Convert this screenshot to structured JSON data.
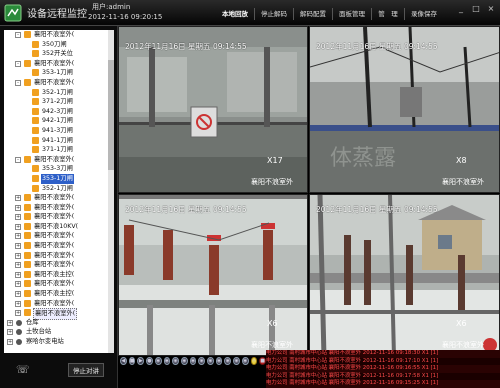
{
  "app": {
    "title": "设备远程监控",
    "user_line": "用户:admin",
    "datetime": "2012-11-16   09:20:15"
  },
  "topnav": [
    "本地回放",
    "停止解码",
    "解码配置",
    "面板管理",
    "管　理",
    "录像保存"
  ],
  "topnav_active": 0,
  "window_buttons": [
    "_",
    "□",
    "×"
  ],
  "tree": [
    {
      "label": "襄阳不浪室外(",
      "level": 1,
      "icon": "camera",
      "expand": "-"
    },
    {
      "label": "350刀闸",
      "level": 2,
      "icon": "camera"
    },
    {
      "label": "352开关位",
      "level": 2,
      "icon": "camera"
    },
    {
      "label": "襄阳不浪室外(",
      "level": 1,
      "icon": "camera",
      "expand": "-"
    },
    {
      "label": "353-1刀闸",
      "level": 2,
      "icon": "camera"
    },
    {
      "label": "襄阳不浪室外(",
      "level": 1,
      "icon": "camera",
      "expand": "-"
    },
    {
      "label": "352-1刀闸",
      "level": 2,
      "icon": "camera"
    },
    {
      "label": "371-2刀闸",
      "level": 2,
      "icon": "camera"
    },
    {
      "label": "942-3刀闸",
      "level": 2,
      "icon": "camera"
    },
    {
      "label": "942-1刀闸",
      "level": 2,
      "icon": "camera"
    },
    {
      "label": "941-3刀闸",
      "level": 2,
      "icon": "camera"
    },
    {
      "label": "941-1刀闸",
      "level": 2,
      "icon": "camera"
    },
    {
      "label": "371-1刀闸",
      "level": 2,
      "icon": "camera"
    },
    {
      "label": "襄阳不浪室外(",
      "level": 1,
      "icon": "camera",
      "expand": "-"
    },
    {
      "label": "353-3刀闸",
      "level": 2,
      "icon": "camera"
    },
    {
      "label": "353-1刀闸",
      "level": 2,
      "icon": "camera",
      "selected": true
    },
    {
      "label": "352-1刀闸",
      "level": 2,
      "icon": "camera"
    },
    {
      "label": "襄阳不浪室外(",
      "level": 1,
      "icon": "camera",
      "expand": "+"
    },
    {
      "label": "襄阳不浪室外(",
      "level": 1,
      "icon": "camera",
      "expand": "+"
    },
    {
      "label": "襄阳不浪室外(",
      "level": 1,
      "icon": "camera",
      "expand": "+"
    },
    {
      "label": "襄阳不浪10KV(",
      "level": 1,
      "icon": "camera",
      "expand": "+"
    },
    {
      "label": "襄阳不浪室外(",
      "level": 1,
      "icon": "camera",
      "expand": "+"
    },
    {
      "label": "襄阳不浪室外(",
      "level": 1,
      "icon": "camera",
      "expand": "+"
    },
    {
      "label": "襄阳不浪室外(",
      "level": 1,
      "icon": "camera",
      "expand": "+"
    },
    {
      "label": "襄阳不浪室外(",
      "level": 1,
      "icon": "camera",
      "expand": "+"
    },
    {
      "label": "襄阳不浪主控(",
      "level": 1,
      "icon": "camera",
      "expand": "+"
    },
    {
      "label": "襄阳不浪室外(",
      "level": 1,
      "icon": "camera",
      "expand": "+"
    },
    {
      "label": "襄阳不浪主控(",
      "level": 1,
      "icon": "camera",
      "expand": "+"
    },
    {
      "label": "襄阳不浪室外(",
      "level": 1,
      "icon": "camera",
      "expand": "+"
    },
    {
      "label": "襄阳不浪室外(",
      "level": 1,
      "icon": "camera",
      "expand": "+",
      "focused": true
    },
    {
      "label": "仓库",
      "level": 0,
      "icon": "station",
      "expand": "+"
    },
    {
      "label": "土牧台站",
      "level": 0,
      "icon": "station",
      "expand": "+"
    },
    {
      "label": "察哈尔变电站",
      "level": 0,
      "icon": "station",
      "expand": "+"
    }
  ],
  "left_footer": {
    "stop_call": "停止对讲"
  },
  "tiles": [
    {
      "timestamp": "2012年11月16日 星期五 09:14:55",
      "cam": "X17",
      "name": "襄阳不浪室外"
    },
    {
      "timestamp": "2012年11月16日 星期五 09:14:55",
      "cam": "X8",
      "name": "襄阳不浪室外"
    },
    {
      "timestamp": "2012年11月16日 星期五 09:14:55",
      "cam": "X6",
      "name": "襄阳不浪室外"
    },
    {
      "timestamp": "2012年11月16日 星期五 09:14:55",
      "cam": "X6",
      "name": "襄阳不浪室外"
    }
  ],
  "controls": [
    "◀",
    "■",
    "▶",
    "●",
    "◉",
    "◉",
    "◉",
    "◉",
    "◉",
    "◉",
    "◉",
    "◉",
    "◉",
    "◉",
    "◉",
    "☼",
    "■"
  ],
  "log": [
    "电力公司  南村城市中心站  襄阳不浪室外  2012-11-16 09:18:30  X1  [1]",
    "电力公司  南村城市中心站  襄阳不浪室外  2012-11-16 09:17:10  X1  [1]",
    "电力公司  南村城市中心站  襄阳不浪室外  2012-11-16 09:16:55  X1  [1]",
    "电力公司  南村城市中心站  襄阳不浪室外  2012-11-16 09:17:58  X1  [1]",
    "电力公司  南村城市中心站  襄阳不浪室外  2012-11-16 09:15:25  X1  [1]"
  ]
}
